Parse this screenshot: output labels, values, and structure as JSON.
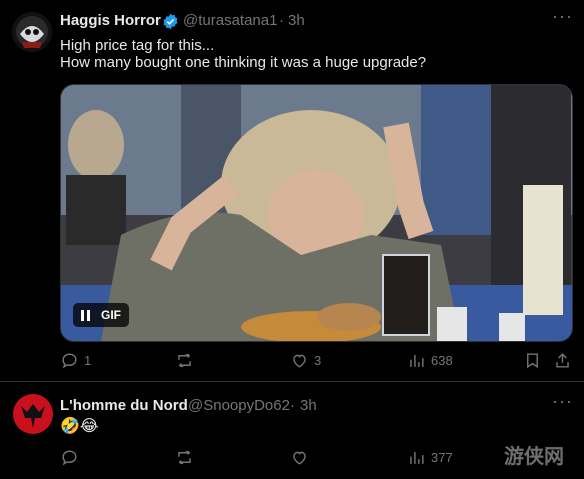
{
  "post1": {
    "name": "Haggis Horror",
    "handle": "@turasatana1",
    "sep": "·",
    "time": "3h",
    "line1": "High price tag for this...",
    "line2": "How many bought one thinking it was a huge upgrade?",
    "gif_label": "GIF",
    "stats": {
      "replies": "1",
      "likes": "3",
      "views": "638"
    }
  },
  "post2": {
    "name": "L'homme du Nord",
    "handle": "@SnoopyDo62",
    "sep": "·",
    "time": "3h",
    "text": "🤣😂",
    "stats": {
      "views": "377"
    }
  },
  "watermark": "游侠网",
  "colors": {
    "bg": "#000000",
    "text": "#e7e9ea",
    "muted": "#71767b",
    "verified": "#1d9bf0",
    "divider": "#2f3336"
  },
  "icons": [
    "reply-icon",
    "repost-icon",
    "like-icon",
    "views-icon",
    "bookmark-icon",
    "share-icon",
    "verified-icon",
    "more-icon",
    "pause-icon"
  ]
}
